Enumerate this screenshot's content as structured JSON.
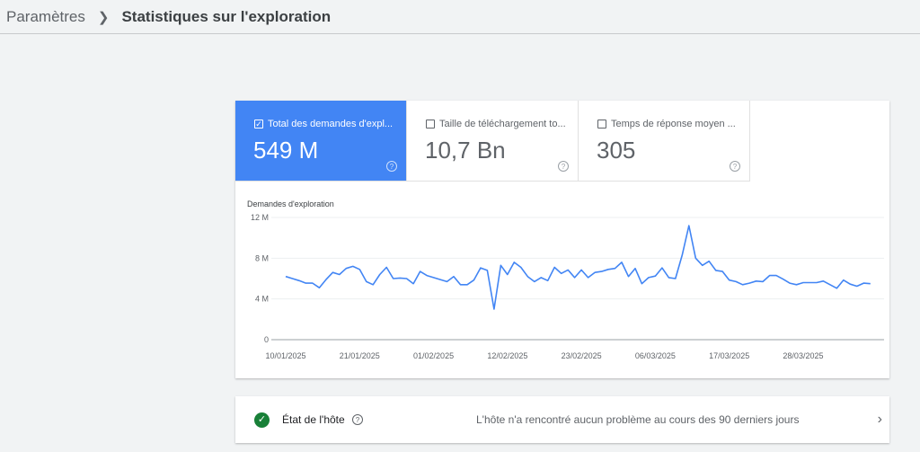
{
  "breadcrumb": {
    "parent": "Paramètres",
    "current": "Statistiques sur l'exploration"
  },
  "metrics": [
    {
      "label": "Total des demandes d'expl...",
      "value": "549 M",
      "checked": true
    },
    {
      "label": "Taille de téléchargement to...",
      "value": "10,7 Bn",
      "checked": false
    },
    {
      "label": "Temps de réponse moyen ...",
      "value": "305",
      "checked": false
    }
  ],
  "help_glyph": "?",
  "check_glyph": "✓",
  "chart_data": {
    "type": "line",
    "title": "Demandes d'exploration",
    "ylabel": "",
    "xlabel": "",
    "ylim": [
      0,
      12
    ],
    "yticks": [
      {
        "v": 0,
        "label": "0"
      },
      {
        "v": 4,
        "label": "4 M"
      },
      {
        "v": 8,
        "label": "8 M"
      },
      {
        "v": 12,
        "label": "12 M"
      }
    ],
    "xticks": [
      {
        "day": 0,
        "label": "10/01/2025"
      },
      {
        "day": 11,
        "label": "21/01/2025"
      },
      {
        "day": 22,
        "label": "01/02/2025"
      },
      {
        "day": 33,
        "label": "12/02/2025"
      },
      {
        "day": 44,
        "label": "23/02/2025"
      },
      {
        "day": 55,
        "label": "06/03/2025"
      },
      {
        "day": 66,
        "label": "17/03/2025"
      },
      {
        "day": 77,
        "label": "28/03/2025"
      }
    ],
    "series": [
      {
        "name": "Demandes d'exploration",
        "color": "#4285f4",
        "values": [
          6.2,
          6.0,
          5.8,
          5.55,
          5.55,
          5.1,
          5.9,
          6.6,
          6.4,
          7.0,
          7.2,
          6.9,
          5.7,
          5.4,
          6.4,
          7.1,
          6.0,
          6.05,
          6.0,
          5.5,
          6.7,
          6.3,
          6.1,
          5.9,
          5.7,
          6.2,
          5.4,
          5.4,
          5.85,
          7.05,
          6.8,
          3.0,
          7.3,
          6.4,
          7.6,
          7.1,
          6.2,
          5.7,
          6.1,
          5.8,
          7.1,
          6.5,
          6.85,
          6.1,
          6.85,
          6.1,
          6.6,
          6.7,
          6.9,
          7.0,
          7.6,
          6.2,
          7.0,
          5.5,
          6.1,
          6.25,
          7.05,
          6.1,
          6.0,
          8.3,
          11.2,
          8.0,
          7.3,
          7.7,
          6.8,
          6.7,
          5.85,
          5.7,
          5.4,
          5.55,
          5.75,
          5.7,
          6.3,
          6.3,
          5.95,
          5.55,
          5.4,
          5.6,
          5.6,
          5.6,
          5.75,
          5.4,
          5.05,
          5.85,
          5.45,
          5.25,
          5.55,
          5.5
        ]
      }
    ]
  },
  "host": {
    "label": "État de l'hôte",
    "message": "L'hôte n'a rencontré aucun problème au cours des 90 derniers jours",
    "chevron": "›"
  }
}
